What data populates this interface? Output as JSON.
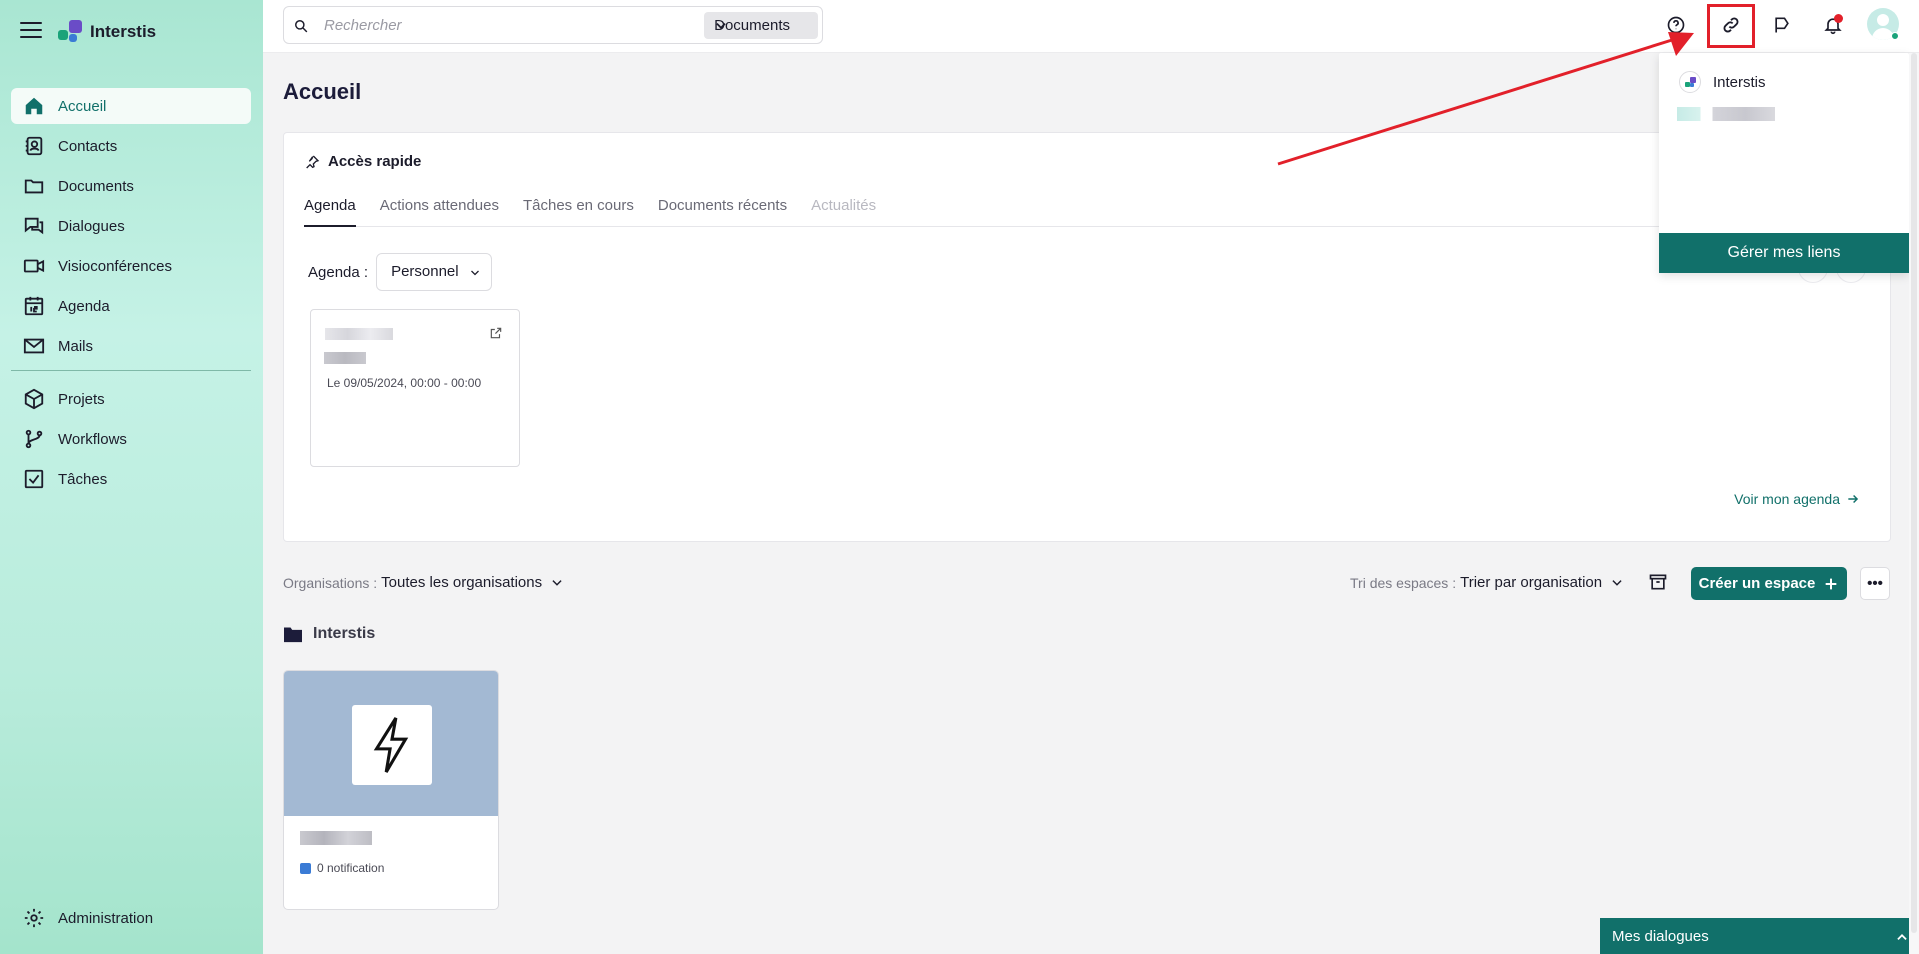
{
  "brand": {
    "name": "Interstis"
  },
  "nav": {
    "items": [
      {
        "label": "Accueil"
      },
      {
        "label": "Contacts"
      },
      {
        "label": "Documents"
      },
      {
        "label": "Dialogues"
      },
      {
        "label": "Visioconférences"
      },
      {
        "label": "Agenda"
      },
      {
        "label": "Mails"
      },
      {
        "label": "Projets"
      },
      {
        "label": "Workflows"
      },
      {
        "label": "Tâches"
      }
    ],
    "admin": "Administration"
  },
  "search": {
    "placeholder": "Rechercher",
    "scope": "Documents"
  },
  "page": {
    "title": "Accueil"
  },
  "quick_access": {
    "title": "Accès rapide",
    "tabs": [
      "Agenda",
      "Actions attendues",
      "Tâches en cours",
      "Documents récents",
      "Actualités"
    ],
    "agenda_label": "Agenda :",
    "agenda_select": "Personnel",
    "event": {
      "date": "Le 09/05/2024, 00:00 - 00:00"
    },
    "see_agenda": "Voir mon agenda"
  },
  "filters": {
    "org_label": "Organisations :",
    "org_value": "Toutes les organisations",
    "sort_label": "Tri des espaces :",
    "sort_value": "Trier par organisation",
    "create_label": "Créer un espace",
    "more_label": "•••"
  },
  "organization": {
    "name": "Interstis",
    "space": {
      "notifications": "0 notification"
    }
  },
  "links_popup": {
    "items": [
      {
        "label": "Interstis"
      }
    ],
    "manage_label": "Gérer mes liens"
  },
  "dialogs_bar": {
    "label": "Mes dialogues"
  },
  "colors": {
    "accent": "#11706a",
    "sidebar": "#bdeedf",
    "highlight": "#e2202a"
  }
}
